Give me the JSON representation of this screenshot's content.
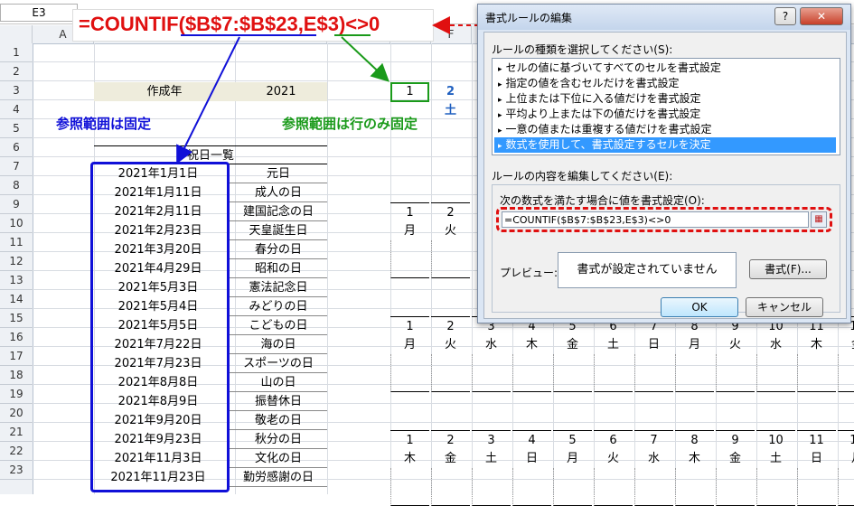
{
  "namebox": "E3",
  "columns": [
    "A",
    "B",
    "C",
    "D",
    "E",
    "F"
  ],
  "rows": [
    "1",
    "2",
    "3",
    "4",
    "5",
    "6",
    "7",
    "8",
    "9",
    "10",
    "11",
    "12",
    "13",
    "14",
    "15",
    "16",
    "17",
    "18",
    "19",
    "20",
    "21",
    "22",
    "23"
  ],
  "year_label": "作成年",
  "year_value": "2021",
  "holiday_header": "祝日一覧",
  "holidays": [
    {
      "date": "2021年1月1日",
      "name": "元日"
    },
    {
      "date": "2021年1月11日",
      "name": "成人の日"
    },
    {
      "date": "2021年2月11日",
      "name": "建国記念の日"
    },
    {
      "date": "2021年2月23日",
      "name": "天皇誕生日"
    },
    {
      "date": "2021年3月20日",
      "name": "春分の日"
    },
    {
      "date": "2021年4月29日",
      "name": "昭和の日"
    },
    {
      "date": "2021年5月3日",
      "name": "憲法記念日"
    },
    {
      "date": "2021年5月4日",
      "name": "みどりの日"
    },
    {
      "date": "2021年5月5日",
      "name": "こどもの日"
    },
    {
      "date": "2021年7月22日",
      "name": "海の日"
    },
    {
      "date": "2021年7月23日",
      "name": "スポーツの日"
    },
    {
      "date": "2021年8月8日",
      "name": "山の日"
    },
    {
      "date": "2021年8月9日",
      "name": "振替休日"
    },
    {
      "date": "2021年9月20日",
      "name": "敬老の日"
    },
    {
      "date": "2021年9月23日",
      "name": "秋分の日"
    },
    {
      "date": "2021年11月3日",
      "name": "文化の日"
    },
    {
      "date": "2021年11月23日",
      "name": "勤労感謝の日"
    }
  ],
  "calendar_top": {
    "e3": "1",
    "f3": "2",
    "f4": "土"
  },
  "cal_block1": {
    "days": [
      "1",
      "2"
    ],
    "weekdays": [
      "月",
      "火"
    ]
  },
  "cal_block2": {
    "days": [
      "1",
      "2",
      "3",
      "4",
      "5",
      "6",
      "7",
      "8",
      "9",
      "10",
      "11",
      "12"
    ],
    "weekdays": [
      "月",
      "火",
      "水",
      "木",
      "金",
      "土",
      "日",
      "月",
      "火",
      "水",
      "木",
      "金"
    ]
  },
  "cal_block3": {
    "days": [
      "1",
      "2",
      "3",
      "4",
      "5",
      "6",
      "7",
      "8",
      "9",
      "10",
      "11",
      "12"
    ],
    "weekdays": [
      "木",
      "金",
      "土",
      "日",
      "月",
      "火",
      "水",
      "木",
      "金",
      "土",
      "日",
      "月"
    ]
  },
  "annotation": {
    "formula": "=COUNTIF($B$7:$B$23,E$3)<>0",
    "fixed_range": "参照範囲は固定",
    "row_fixed": "参照範囲は行のみ固定"
  },
  "dialog": {
    "title": "書式ルールの編集",
    "help": "?",
    "close": "✕",
    "select_type_label": "ルールの種類を選択してください(S):",
    "rule_types": [
      "セルの値に基づいてすべてのセルを書式設定",
      "指定の値を含むセルだけを書式設定",
      "上位または下位に入る値だけを書式設定",
      "平均より上または下の値だけを書式設定",
      "一意の値または重複する値だけを書式設定",
      "数式を使用して、書式設定するセルを決定"
    ],
    "edit_label": "ルールの内容を編集してください(E):",
    "formula_label": "次の数式を満たす場合に値を書式設定(O):",
    "formula_value": "=COUNTIF($B$7:$B$23,E$3)<>0",
    "preview_label": "プレビュー:",
    "preview_text": "書式が設定されていません",
    "format_button": "書式(F)...",
    "ok": "OK",
    "cancel": "キャンセル"
  },
  "colors": {
    "blue": "#1010d8",
    "green": "#1a9a1a",
    "red": "#e01010",
    "selected": "#3399ff"
  }
}
